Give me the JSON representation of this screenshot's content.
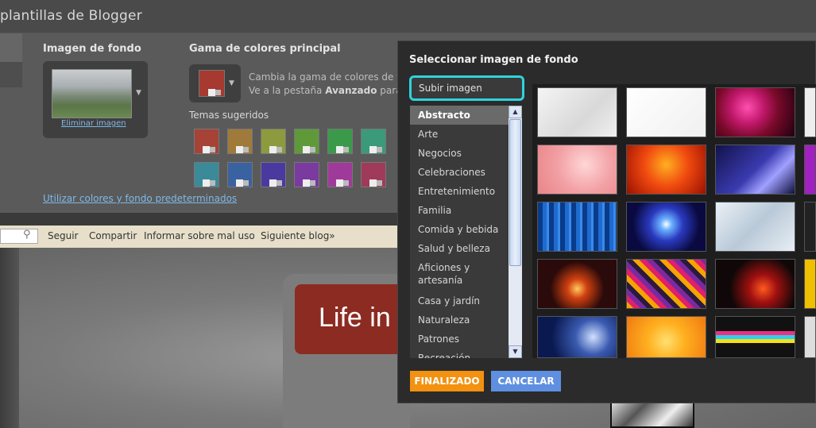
{
  "app": {
    "title": "plantillas de Blogger"
  },
  "designer": {
    "background_section": {
      "title": "Imagen de fondo",
      "remove_link": "Eliminar imagen"
    },
    "color_section": {
      "title": "Gama de colores principal",
      "desc_line1": "Cambia la gama de colores de t",
      "desc_line2_prefix": "Ve a la pestaña ",
      "desc_line2_bold": "Avanzado",
      "desc_line2_suffix": " para",
      "suggested_title": "Temas sugeridos",
      "main_color": "#a63a30",
      "swatches": [
        "#a64236",
        "#a07a3a",
        "#8d9a3e",
        "#5f9a3a",
        "#3a9a4a",
        "#3a9a7a",
        "#3a8a9a",
        "#3a62a0",
        "#4a3aa0",
        "#7a3aa0",
        "#a03a9a",
        "#a03a5a"
      ]
    },
    "defaults_link": "Utilizar colores y fondo predeterminados"
  },
  "navbar": {
    "links": [
      "Seguir",
      "Compartir",
      "Informar sobre mal uso",
      "Siguiente blog»"
    ]
  },
  "preview": {
    "blog_title": "Life in"
  },
  "dialog": {
    "title": "Seleccionar imagen de fondo",
    "upload_button": "Subir imagen",
    "categories": [
      "Abstracto",
      "Arte",
      "Negocios",
      "Celebraciones",
      "Entretenimiento",
      "Familia",
      "Comida y bebida",
      "Salud y belleza",
      "Aficiones y artesanía",
      "Casa y jardín",
      "Naturaleza",
      "Patrones",
      "Recreación"
    ],
    "selected_category": "Abstracto",
    "done_button": "FINALIZADO",
    "cancel_button": "CANCELAR",
    "accent_color": "#2ed3dc"
  }
}
